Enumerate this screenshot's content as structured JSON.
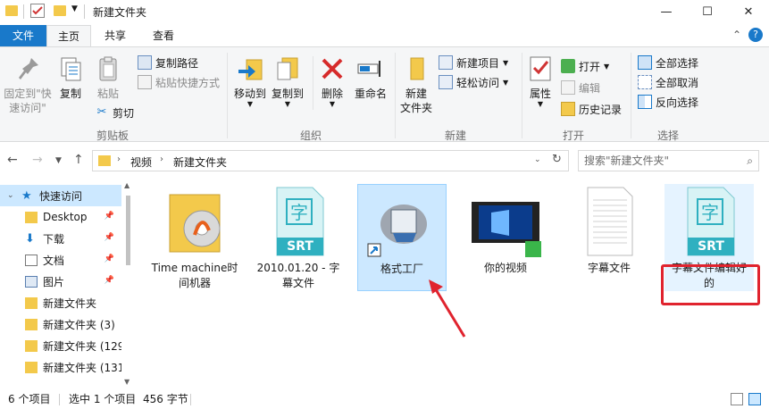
{
  "window": {
    "title": "新建文件夹",
    "minimize": "—",
    "maximize": "☐",
    "close": "✕",
    "expand_ribbon": "⌃",
    "help": "?"
  },
  "tabs": [
    "文件",
    "主页",
    "共享",
    "查看"
  ],
  "ribbon": {
    "clipboard": {
      "label": "剪贴板",
      "pin": "固定到\"快\n速访问\"",
      "copy": "复制",
      "paste": "粘贴",
      "copy_path": "复制路径",
      "paste_shortcut": "粘贴快捷方式",
      "cut": "剪切"
    },
    "organize": {
      "label": "组织",
      "move_to": "移动到",
      "copy_to": "复制到",
      "delete": "删除",
      "rename": "重命名"
    },
    "new": {
      "label": "新建",
      "new_folder": "新建\n文件夹",
      "new_item": "新建项目",
      "easy_access": "轻松访问"
    },
    "open": {
      "label": "打开",
      "properties": "属性",
      "open": "打开",
      "edit": "编辑",
      "history": "历史记录"
    },
    "select": {
      "label": "选择",
      "select_all": "全部选择",
      "select_none": "全部取消",
      "invert": "反向选择"
    }
  },
  "address": {
    "path": [
      "视频",
      "新建文件夹"
    ],
    "search_placeholder": "搜索\"新建文件夹\""
  },
  "nav": [
    {
      "label": "快速访问",
      "icon": "star-icon",
      "pinned": false
    },
    {
      "label": "Desktop",
      "icon": "folder-icon",
      "pinned": true
    },
    {
      "label": "下载",
      "icon": "download-icon",
      "pinned": true
    },
    {
      "label": "文档",
      "icon": "document-icon",
      "pinned": true
    },
    {
      "label": "图片",
      "icon": "picture-icon",
      "pinned": true
    },
    {
      "label": "新建文件夹",
      "icon": "folder-icon",
      "pinned": false
    },
    {
      "label": "新建文件夹 (3)",
      "icon": "folder-icon",
      "pinned": false
    },
    {
      "label": "新建文件夹 (129",
      "icon": "folder-icon",
      "pinned": false
    },
    {
      "label": "新建文件夹 (131",
      "icon": "folder-icon",
      "pinned": false
    }
  ],
  "files": [
    {
      "label": "Time machine时\n间机器",
      "icon": "folder-icon"
    },
    {
      "label": "2010.01.20 - 字\n幕文件",
      "icon": "srt-file-icon",
      "badge": "SRT",
      "glyph": "字"
    },
    {
      "label": "格式工厂",
      "icon": "shortcut-app-icon",
      "selected": true
    },
    {
      "label": "你的视频",
      "icon": "video-file-icon"
    },
    {
      "label": "字幕文件",
      "icon": "text-file-icon"
    },
    {
      "label": "字幕文件编辑好\n的",
      "icon": "srt-file-icon",
      "badge": "SRT",
      "glyph": "字"
    }
  ],
  "status": {
    "count": "6 个项目",
    "selected": "选中 1 个项目",
    "size": "456 字节"
  },
  "colors": {
    "accent": "#1979ca",
    "selection": "#cce8ff",
    "highlight": "#e0232e"
  }
}
